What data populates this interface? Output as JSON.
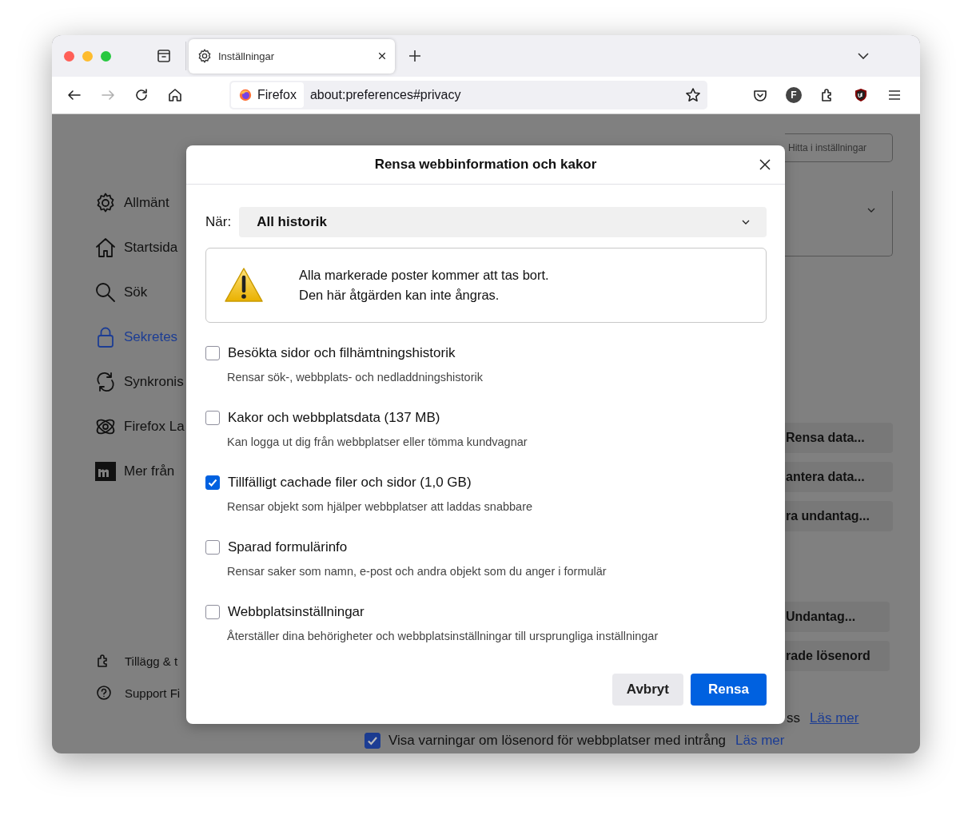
{
  "tab": {
    "title": "Inställningar",
    "selected": true
  },
  "nav_buttons": [
    {
      "kind": "back",
      "disabled": false
    },
    {
      "kind": "forward",
      "disabled": true
    },
    {
      "kind": "reload",
      "disabled": false
    },
    {
      "kind": "home",
      "disabled": false
    }
  ],
  "url_bar": {
    "identity": "Firefox",
    "url": "about:preferences#privacy"
  },
  "toolbar_avatar": "F",
  "settings_search": {
    "placeholder": "Hitta i inställningar"
  },
  "sidebar": {
    "items": [
      {
        "kind": "gear",
        "label": "Allmänt",
        "selected": false
      },
      {
        "kind": "home",
        "label": "Startsida",
        "selected": false
      },
      {
        "kind": "search",
        "label": "Sök",
        "selected": false
      },
      {
        "kind": "lock",
        "label": "Sekretes",
        "selected": true
      },
      {
        "kind": "sync",
        "label": "Synkronis",
        "selected": false
      },
      {
        "kind": "labs",
        "label": "Firefox La",
        "selected": false
      },
      {
        "kind": "brand",
        "label": "Mer från",
        "selected": false
      }
    ],
    "footer": [
      {
        "kind": "puzzle",
        "label": "Tillägg & t"
      },
      {
        "kind": "help",
        "label": "Support Fi"
      }
    ]
  },
  "background_buttons": [
    {
      "label": "Rensa data..."
    },
    {
      "label": "antera data..."
    },
    {
      "label": "ra undantag..."
    },
    {
      "label": "Undantag..."
    },
    {
      "label": "rade lösenord"
    }
  ],
  "background_note": {
    "text": "ss",
    "link": "Läs mer"
  },
  "background_checkbox": {
    "label": "Visa varningar om lösenord för webbplatser med intrång",
    "link": "Läs mer",
    "checked": true
  },
  "dialog": {
    "title": "Rensa webbinformation och kakor",
    "when_label": "När:",
    "when_value": "All historik",
    "warning": [
      "Alla markerade poster kommer att tas bort.",
      "Den här åtgärden kan inte ångras."
    ],
    "items": [
      {
        "label": "Besökta sidor och filhämtningshistorik",
        "description": "Rensar sök-, webbplats- och nedladdningshistorik",
        "checked": false
      },
      {
        "label": "Kakor och webbplatsdata (137 MB)",
        "description": "Kan logga ut dig från webbplatser eller tömma kundvagnar",
        "checked": false
      },
      {
        "label": "Tillfälligt cachade filer och sidor (1,0 GB)",
        "description": "Rensar objekt som hjälper webbplatser att laddas snabbare",
        "checked": true
      },
      {
        "label": "Sparad formulärinfo",
        "description": "Rensar saker som namn, e-post och andra objekt som du anger i formulär",
        "checked": false
      },
      {
        "label": "Webbplatsinställningar",
        "description": "Återställer dina behörigheter och webbplatsinställningar till ursprungliga inställningar",
        "checked": false
      }
    ],
    "buttons": [
      {
        "kind": "secondary",
        "label": "Avbryt"
      },
      {
        "kind": "primary",
        "label": "Rensa"
      }
    ]
  }
}
